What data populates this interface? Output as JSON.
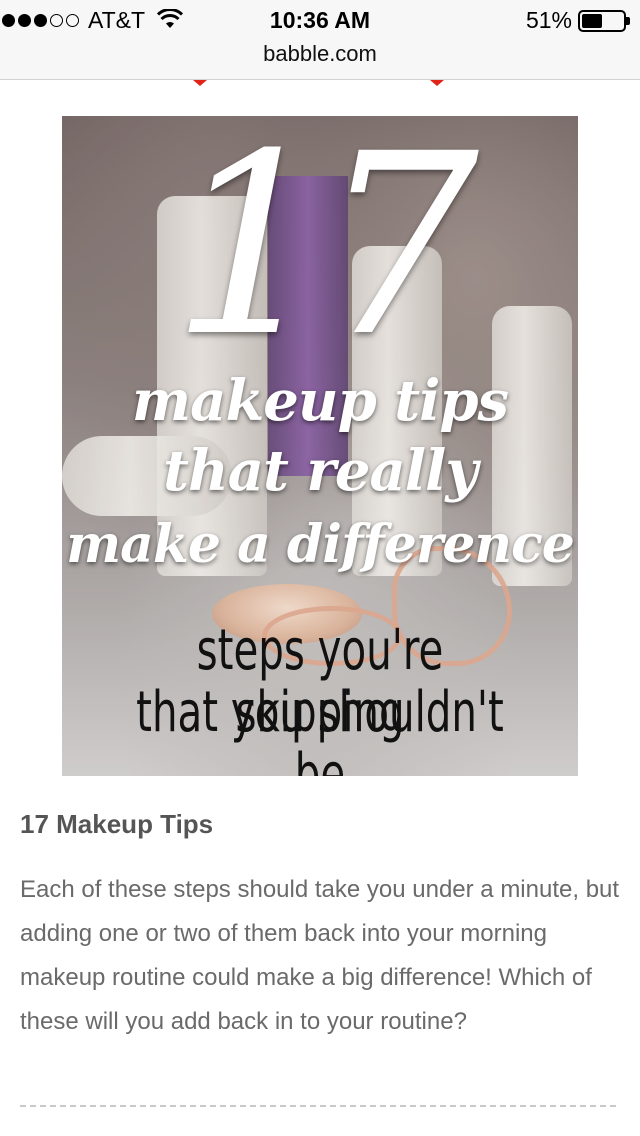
{
  "status_bar": {
    "carrier": "AT&T",
    "signal_bars_filled": 3,
    "signal_bars_total": 5,
    "time": "10:36 AM",
    "battery_percent_label": "51%",
    "battery_level": 0.51
  },
  "browser": {
    "url": "babble.com"
  },
  "hero_image": {
    "number": "17",
    "line1": "makeup tips",
    "line2": "that really",
    "line3": "make a difference",
    "sub1": "steps you're skipping",
    "sub2": "that you shouldn't be"
  },
  "article": {
    "title": "17 Makeup Tips",
    "body": "Each of these steps should take you under a minute, but adding one or two of them back into your morning makeup routine could make a big difference! Which of these will you add back in to your routine?"
  },
  "colors": {
    "accent_red": "#e2231a",
    "title_gray": "#555555",
    "body_gray": "#6a6a6a"
  }
}
